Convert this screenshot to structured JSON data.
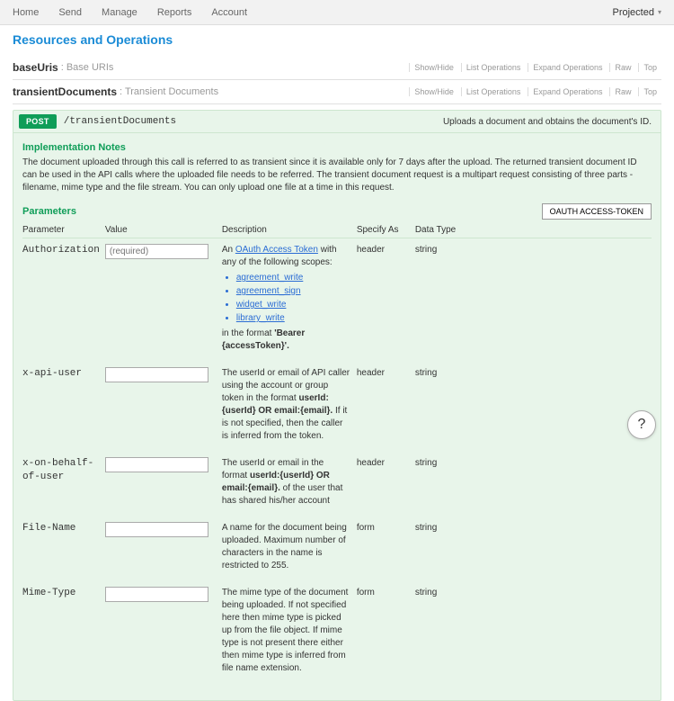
{
  "nav": {
    "items": [
      "Home",
      "Send",
      "Manage",
      "Reports",
      "Account"
    ],
    "account_label": "Projected"
  },
  "page": {
    "title": "Resources and Operations"
  },
  "sections": [
    {
      "name": "baseUris",
      "sub": ": Base URIs",
      "crumbs": [
        "Show/Hide",
        "List Operations",
        "Expand Operations",
        "Raw",
        "Top"
      ]
    },
    {
      "name": "transientDocuments",
      "sub": ": Transient Documents",
      "crumbs": [
        "Show/Hide",
        "List Operations",
        "Expand Operations",
        "Raw",
        "Top"
      ]
    }
  ],
  "operation": {
    "badge": "POST",
    "path": "/transientDocuments",
    "summary": "Uploads a document and obtains the document's ID.",
    "impl_title": "Implementation Notes",
    "impl_notes": "The document uploaded through this call is referred to as transient since it is available only for 7 days after the upload. The returned transient document ID can be used in the API calls where the uploaded file needs to be referred. The transient document request is a multipart request consisting of three parts - filename, mime type and the file stream. You can only upload one file at a time in this request.",
    "params_title": "Parameters",
    "oauth_button": "OAUTH ACCESS-TOKEN",
    "headers": {
      "param": "Parameter",
      "value": "Value",
      "desc": "Description",
      "spec": "Specify As",
      "type": "Data Type"
    },
    "auth_desc": {
      "pre": "An ",
      "link": "OAuth Access Token",
      "post": " with any of the following scopes:",
      "scopes": [
        "agreement_write",
        "agreement_sign",
        "widget_write",
        "library_write"
      ],
      "tail_pre": "in the format ",
      "tail_bold": "'Bearer {accessToken}'."
    },
    "xapi_desc": {
      "pre": "The userId or email of API caller using the account or group token in the format ",
      "bold": "userId:{userId} OR email:{email}.",
      "post": " If it is not specified, then the caller is inferred from the token."
    },
    "onbehalf_desc": {
      "pre": "The userId or email in the format ",
      "bold": "userId:{userId} OR email:{email}.",
      "post": " of the user that has shared his/her account"
    },
    "rows": [
      {
        "name": "Authorization",
        "placeholder": "(required)",
        "spec": "header",
        "type": "string"
      },
      {
        "name": "x-api-user",
        "placeholder": "",
        "spec": "header",
        "type": "string"
      },
      {
        "name": "x-on-behalf-of-user",
        "placeholder": "",
        "spec": "header",
        "type": "string"
      },
      {
        "name": "File-Name",
        "placeholder": "",
        "desc": "A name for the document being uploaded. Maximum number of characters in the name is restricted to 255.",
        "spec": "form",
        "type": "string"
      },
      {
        "name": "Mime-Type",
        "placeholder": "",
        "desc": "The mime type of the document being uploaded. If not specified here then mime type is picked up from the file object. If mime type is not present there either then mime type is inferred from file name extension.",
        "spec": "form",
        "type": "string"
      }
    ]
  },
  "help": {
    "label": "?"
  }
}
